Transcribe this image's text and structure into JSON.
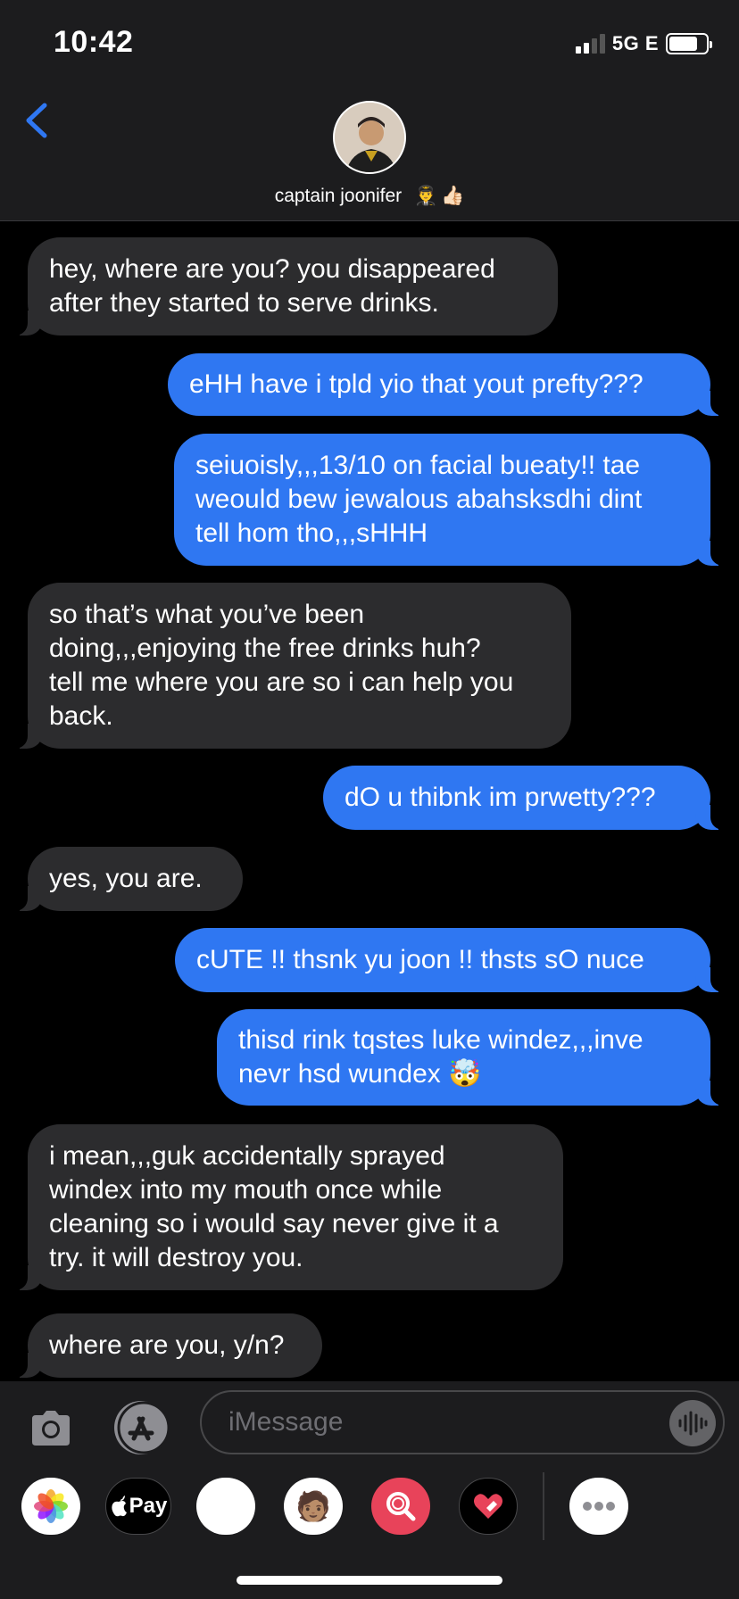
{
  "status": {
    "time": "10:42",
    "network": "5G E"
  },
  "contact": {
    "name": "captain joonifer"
  },
  "messages": [
    {
      "from": "them",
      "text": "hey, where are you? you disappeared\nafter they started to serve drinks."
    },
    {
      "from": "me",
      "text": "eHH have i tpld yio that yout prefty???"
    },
    {
      "from": "me",
      "text": "seiuoisly,,,13/10 on facial bueaty!! tae\nweould bew jewalous abahsksdhi dint\ntell hom tho,,,sHHH"
    },
    {
      "from": "them",
      "text": "so that’s what you’ve been\ndoing,,,enjoying the free drinks huh?\ntell me where you are so i can help you\nback."
    },
    {
      "from": "me",
      "text": "dO u thibnk im prwetty???"
    },
    {
      "from": "them",
      "text": "yes, you are."
    },
    {
      "from": "me",
      "text": "cUTE !! thsnk yu joon !! thsts sO nuce"
    },
    {
      "from": "me",
      "text": "thisd rink tqstes luke windez,,,inve\nnevr hsd wundex 🤯"
    },
    {
      "from": "them",
      "text": "i mean,,,guk accidentally sprayed\nwindex into my mouth once while\ncleaning so i would say never give it a\ntry. it will destroy you."
    },
    {
      "from": "them",
      "text": "where are you, y/n?"
    }
  ],
  "composer": {
    "placeholder": "iMessage"
  },
  "app_drawer": {
    "apple_pay_label": "Pay"
  },
  "icons": {
    "back": "chevron-left-icon",
    "camera": "camera-icon",
    "appstore": "app-store-icon",
    "audio": "audio-waveform-icon",
    "photos": "photos-app-icon",
    "apple_pay": "apple-pay-icon",
    "animoji": "monkey-animoji-icon",
    "memoji": "memoji-stickers-icon",
    "images_search": "images-search-icon",
    "digital_touch": "digital-touch-icon",
    "more": "more-apps-icon"
  },
  "colors": {
    "sent_bubble": "#2f77f2",
    "received_bubble": "#2c2c2e",
    "accent": "#2f77f2"
  }
}
